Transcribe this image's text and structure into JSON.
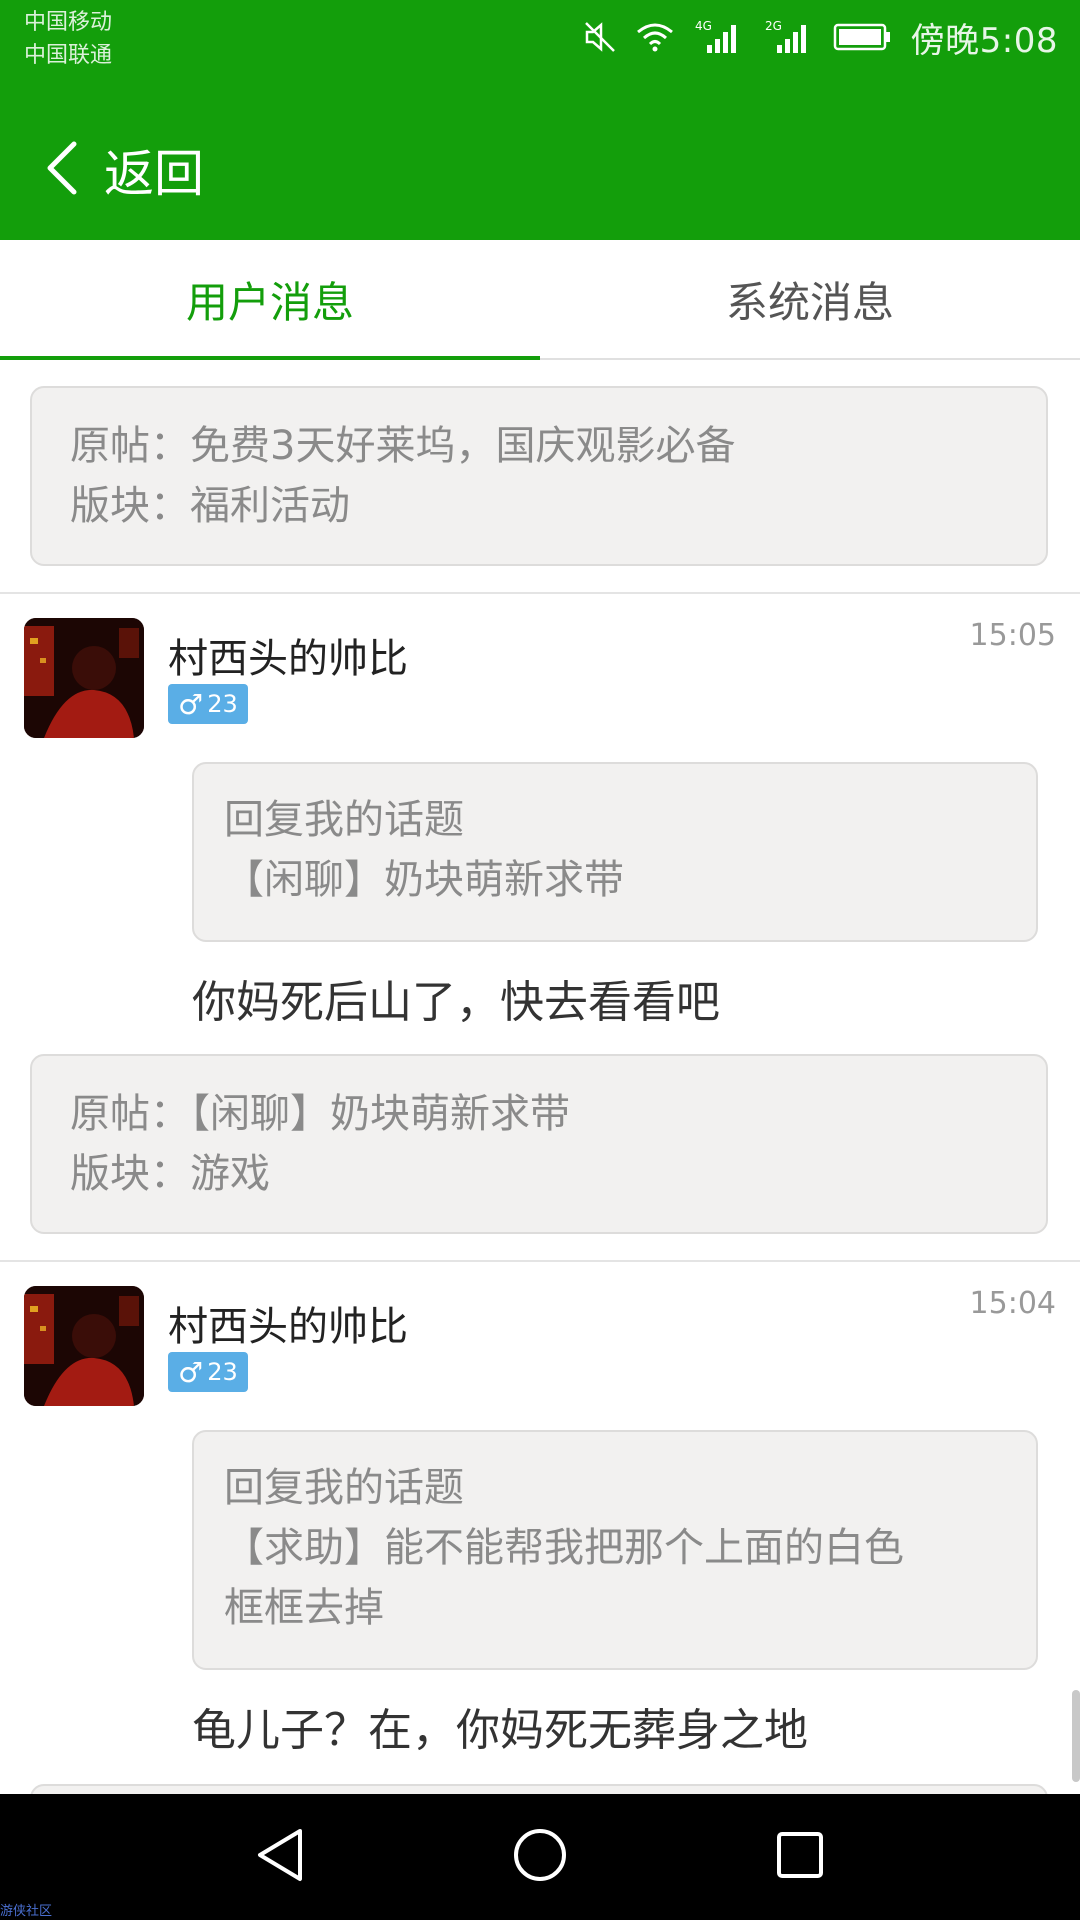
{
  "status_bar": {
    "carrier1": "中国移动",
    "carrier2": "中国联通",
    "network1": "4G",
    "network2": "2G",
    "time": "傍晚5:08"
  },
  "header": {
    "back_label": "返回",
    "color": "#139E0B"
  },
  "tabs": [
    {
      "label": "用户消息",
      "active": true
    },
    {
      "label": "系统消息",
      "active": false
    }
  ],
  "origin_labels": {
    "post_prefix": "原帖：",
    "board_prefix": "版块："
  },
  "origin_top": {
    "post": "免费3天好莱坞，国庆观影必备",
    "board": "福利活动"
  },
  "messages": [
    {
      "user": "村西头的帅比",
      "gender_symbol": "♂",
      "level": "23",
      "time": "15:05",
      "reply_title": "回复我的话题",
      "topic": "【闲聊】奶块萌新求带",
      "text": "你妈死后山了，快去看看吧",
      "origin_post": "【闲聊】奶块萌新求带",
      "origin_board": "游戏"
    },
    {
      "user": "村西头的帅比",
      "gender_symbol": "♂",
      "level": "23",
      "time": "15:04",
      "reply_title": "回复我的话题",
      "topic_line1": "【求助】能不能帮我把那个上面的白色",
      "topic_line2": "框框去掉",
      "text": "龟儿子？在，你妈死无葬身之地"
    }
  ],
  "watermark": "游侠社区"
}
